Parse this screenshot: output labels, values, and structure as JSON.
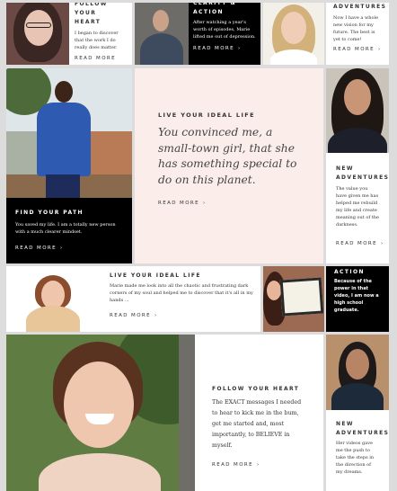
{
  "tiles": {
    "t1": {
      "heading": "Follow your heart",
      "body": "I began to discover that the work I do really does matter.",
      "link": "Read more",
      "arrow": "›"
    },
    "t2": {
      "heading": "Clarity & Action",
      "body": "After watching a year's worth of episodes, Marie lifted me out of depression.",
      "link": "Read more",
      "arrow": "›"
    },
    "t3": {
      "heading": "Adventures",
      "body": "Now I have a whole new vision for my future. The best is yet to come!",
      "link": "Read more",
      "arrow": "›"
    },
    "t4": {
      "heading": "Find your path",
      "body": "You saved my life. I am a totally new person with a much clearer mindset.",
      "link": "Read more",
      "arrow": "›"
    },
    "t5": {
      "eyebrow": "Live your ideal life",
      "quote": "You convinced me, a small-town girl, that she has something special to do on this planet.",
      "link": "Read more",
      "arrow": "›"
    },
    "t6": {
      "heading": "New Adventures",
      "body": "The value you have given me has helped me rebuild my life and create meaning out of the darkness.",
      "link": "Read more",
      "arrow": "›"
    },
    "t7": {
      "heading": "Live your ideal life",
      "body": "Marie made me look into all the chaotic and frustrating dark corners of my soul and helped me to discover that it's all in my hands ...",
      "link": "Read more",
      "arrow": "›"
    },
    "t8": {
      "heading": "Action",
      "body": "Because of the power in that video, I am now a high school graduate."
    },
    "t9": {
      "heading": "Follow your heart",
      "body": "The EXACT messages I needed to hear to kick me in the bum, get me started and, most importantly, to BELIEVE in myself.",
      "link": "Read more",
      "arrow": "›"
    },
    "t10": {
      "heading": "New Adventures",
      "body": "Her videos gave me the push to take the steps in the direction of my dreams."
    }
  },
  "colors": {
    "background": "#dcdcdc",
    "pink": "#fbeeea",
    "black": "#000000",
    "white": "#ffffff"
  }
}
